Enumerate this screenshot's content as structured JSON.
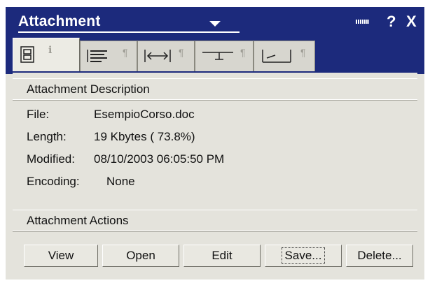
{
  "titlebar": {
    "title": "Attachment",
    "help_label": "?",
    "close_label": "X"
  },
  "tabs": [
    {
      "icon": "document-properties-icon",
      "active": true
    },
    {
      "icon": "paragraph-alignment-icon",
      "active": false
    },
    {
      "icon": "width-arrows-icon",
      "active": false
    },
    {
      "icon": "tab-stop-icon",
      "active": false
    },
    {
      "icon": "return-line-icon",
      "active": false
    }
  ],
  "description": {
    "header": "Attachment Description",
    "rows": [
      {
        "label": "File:",
        "value": "EsempioCorso.doc"
      },
      {
        "label": "Length:",
        "value": "19 Kbytes ( 73.8%)"
      },
      {
        "label": "Modified:",
        "value": "08/10/2003 06:05:50 PM"
      },
      {
        "label": "Encoding:",
        "value": "None"
      }
    ]
  },
  "actions": {
    "header": "Attachment Actions",
    "view": "View",
    "open": "Open",
    "edit": "Edit",
    "save": "Save...",
    "delete": "Delete..."
  },
  "colors": {
    "titlebar": "#1c2a7c",
    "panel": "#e4e3dc"
  }
}
